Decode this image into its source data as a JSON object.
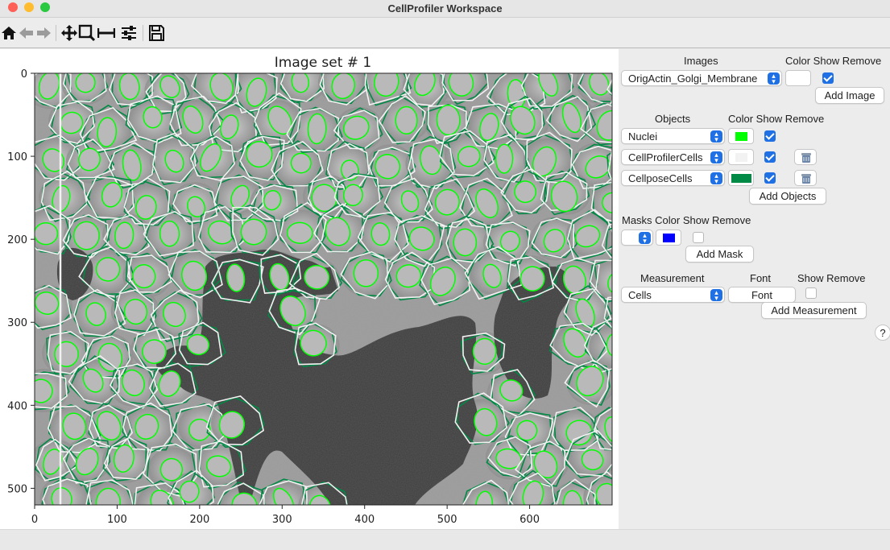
{
  "window": {
    "title": "CellProfiler Workspace",
    "traffic_lights": {
      "close": "#fe5f57",
      "minimize": "#febc2e",
      "zoom": "#28c840"
    }
  },
  "toolbar": {
    "tools": [
      "home-icon",
      "back-arrow-icon",
      "forward-arrow-icon",
      "pan-icon",
      "zoom-icon",
      "subplot-width-icon",
      "configure-icon",
      "save-icon"
    ]
  },
  "figure": {
    "title": "Image set # 1",
    "x_ticks": [
      "0",
      "100",
      "200",
      "300",
      "400",
      "500",
      "600"
    ],
    "y_ticks": [
      "0",
      "100",
      "200",
      "300",
      "400",
      "500"
    ],
    "colors": {
      "nuclei_outline": "#00ff00",
      "cellprofiler_outline": "#f2f2f2",
      "cellpose_outline": "#008a45"
    }
  },
  "panel": {
    "images": {
      "header": "Images",
      "col_headers": "Color Show Remove",
      "rows": [
        {
          "name": "OrigActin_Golgi_Membrane",
          "color": "#ffffff",
          "show": true
        }
      ],
      "add_label": "Add Image"
    },
    "objects": {
      "header": "Objects",
      "col_headers": "Color Show Remove",
      "rows": [
        {
          "name": "Nuclei",
          "color": "#00ff00",
          "show": true,
          "removable": false
        },
        {
          "name": "CellProfilerCells",
          "color": "#f2f2f2",
          "show": true,
          "removable": true
        },
        {
          "name": "CellposeCells",
          "color": "#008a45",
          "show": true,
          "removable": true
        }
      ],
      "add_label": "Add Objects"
    },
    "masks": {
      "header": "Masks Color Show Remove",
      "rows": [
        {
          "name": "",
          "color": "#0000ff",
          "show": false
        }
      ],
      "add_label": "Add Mask"
    },
    "measurements": {
      "header": "Measurement",
      "font_header": "Font",
      "show_remove_header": "Show Remove",
      "rows": [
        {
          "name": "Cells",
          "font_label": "Font",
          "show": false
        }
      ],
      "add_label": "Add Measurement"
    },
    "help_label": "?"
  }
}
